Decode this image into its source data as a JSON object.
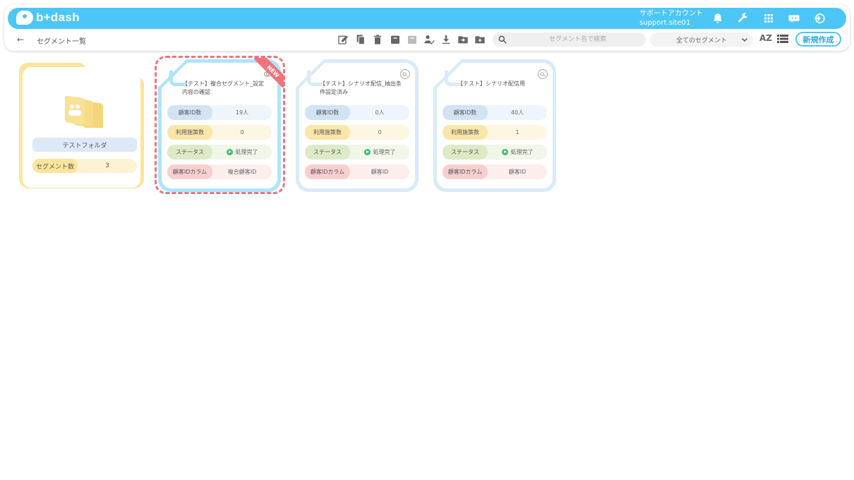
{
  "header": {
    "logo_text": "b+dash",
    "account_name": "サポートアカウント",
    "account_site": "support.site01",
    "brand_color": "#4cc6f7",
    "icons": [
      "bell-icon",
      "wrench-icon",
      "apps-grid-icon",
      "chat-bot-icon",
      "logout-icon"
    ]
  },
  "toolbar": {
    "back_symbol": "←",
    "breadcrumb": "セグメント一覧",
    "search_placeholder": "セグメント名で検索",
    "filter_selected": "全てのセグメント",
    "sort_label": "AZ",
    "new_button": "新規作成",
    "icons": [
      "edit-icon",
      "copy-icon",
      "trash-icon",
      "archive-icon",
      "unarchive-icon",
      "user-check-icon",
      "download-icon",
      "move-folder-icon",
      "new-folder-icon"
    ]
  },
  "folder": {
    "name": "テストフォルダ",
    "count_label": "セグメント数",
    "count_value": "3"
  },
  "cards": [
    {
      "title": "【テスト】複合セグメント_設定内容の確認",
      "is_new": true,
      "new_label": "NEW",
      "rows": {
        "customer_count_label": "顧客ID数",
        "customer_count": "19人",
        "usage_label": "利用施策数",
        "usage": "0",
        "status_label": "ステータス",
        "status": "処理完了",
        "id_column_label": "顧客IDカラム",
        "id_column": "複合顧客ID"
      }
    },
    {
      "title": "【テスト】シナリオ配信_抽出条件設定済み",
      "is_new": false,
      "rows": {
        "customer_count_label": "顧客ID数",
        "customer_count": "0人",
        "usage_label": "利用施策数",
        "usage": "0",
        "status_label": "ステータス",
        "status": "処理完了",
        "id_column_label": "顧客IDカラム",
        "id_column": "顧客ID"
      }
    },
    {
      "title": "【テスト】シナリオ配信用",
      "is_new": false,
      "rows": {
        "customer_count_label": "顧客ID数",
        "customer_count": "40人",
        "usage_label": "利用施策数",
        "usage": "1",
        "status_label": "ステータス",
        "status": "処理完了",
        "id_column_label": "顧客IDカラム",
        "id_column": "顧客ID"
      }
    }
  ]
}
